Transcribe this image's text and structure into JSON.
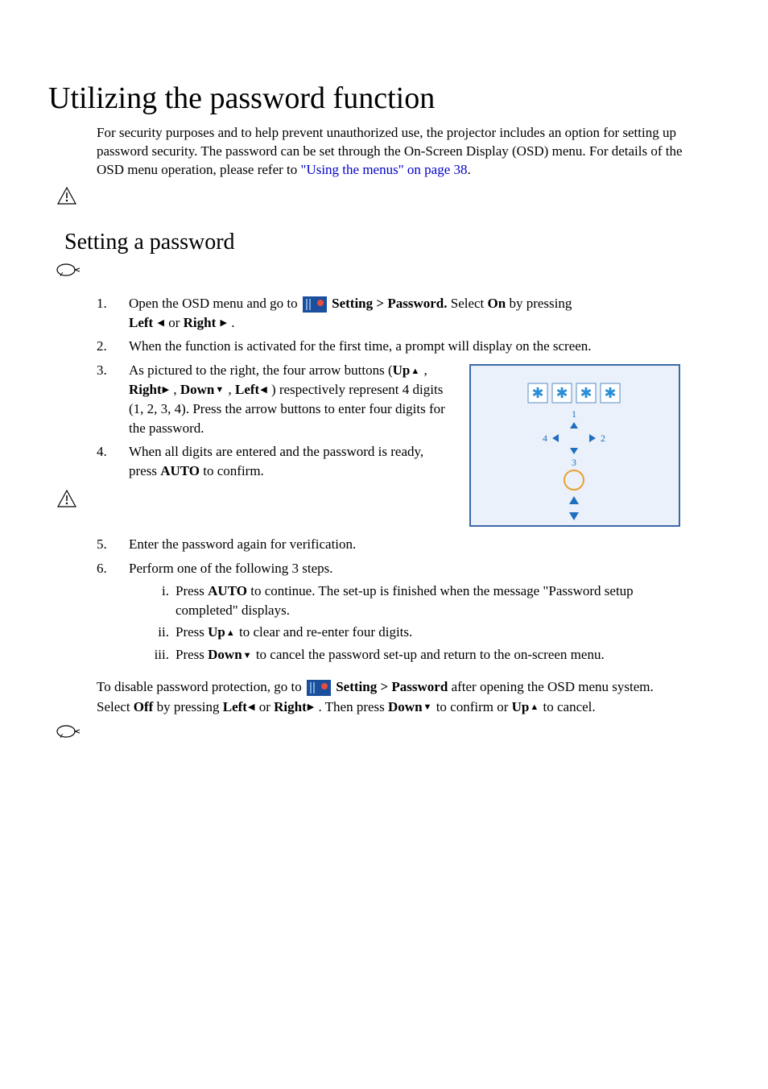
{
  "title": "Utilizing the password function",
  "intro": {
    "text": "For security purposes and to help prevent unauthorized use, the projector includes an option for setting up password security. The password can be set through the On-Screen Display (OSD) menu. For details of the OSD menu operation, please refer to ",
    "link": "\"Using the menus\" on page 38",
    "after": "."
  },
  "section": "Setting a password",
  "steps": {
    "s1a": "Open the OSD menu and go to ",
    "s1b": "Setting > Password.",
    "s1c": " Select ",
    "s1d": "On",
    "s1e": " by pressing ",
    "s1_left": "Left",
    "s1_or": " or ",
    "s1_right": "Right",
    "s1_end": " .",
    "s2": "When the function is activated for the first time, a prompt will display on the screen.",
    "s3a": "As pictured to the right, the four arrow buttons (",
    "s3_up": "Up",
    "s3b": " , ",
    "s3_right": "Right",
    "s3c": " , ",
    "s3_down": "Down",
    "s3d": " , ",
    "s3_left": "Left",
    "s3e": " ) respectively represent 4 digits (1, 2, 3, 4).  Press the arrow buttons to enter four digits for the password.",
    "s4a": "When all digits are entered and the password is ready, press ",
    "s4_auto": "AUTO",
    "s4b": " to confirm.",
    "s5": "Enter the password again for verification.",
    "s6": "Perform one of the following 3 steps.",
    "s6i_a": "Press ",
    "s6i_auto": "AUTO",
    "s6i_b": " to continue. The set-up is finished when the message \"Password setup completed\" displays.",
    "s6ii_a": "Press ",
    "s6ii_up": "Up",
    "s6ii_b": " to clear and re-enter four digits.",
    "s6iii_a": "Press ",
    "s6iii_down": "Down",
    "s6iii_b": " to cancel the password set-up and return to the on-screen menu."
  },
  "disable": {
    "a": "To disable password protection, go to ",
    "b": "Setting > Password",
    "c": " after opening the OSD menu system. Select ",
    "off": "Off",
    "d": " by pressing ",
    "left": "Left",
    "e": " or ",
    "right": "Right",
    "f": " . Then press ",
    "down": "Down",
    "g": " to confirm or ",
    "up": "Up",
    "h": " to cancel."
  },
  "nums": [
    "1.",
    "2.",
    "3.",
    "4.",
    "5.",
    "6."
  ],
  "romans": [
    "i.",
    "ii.",
    "iii."
  ]
}
